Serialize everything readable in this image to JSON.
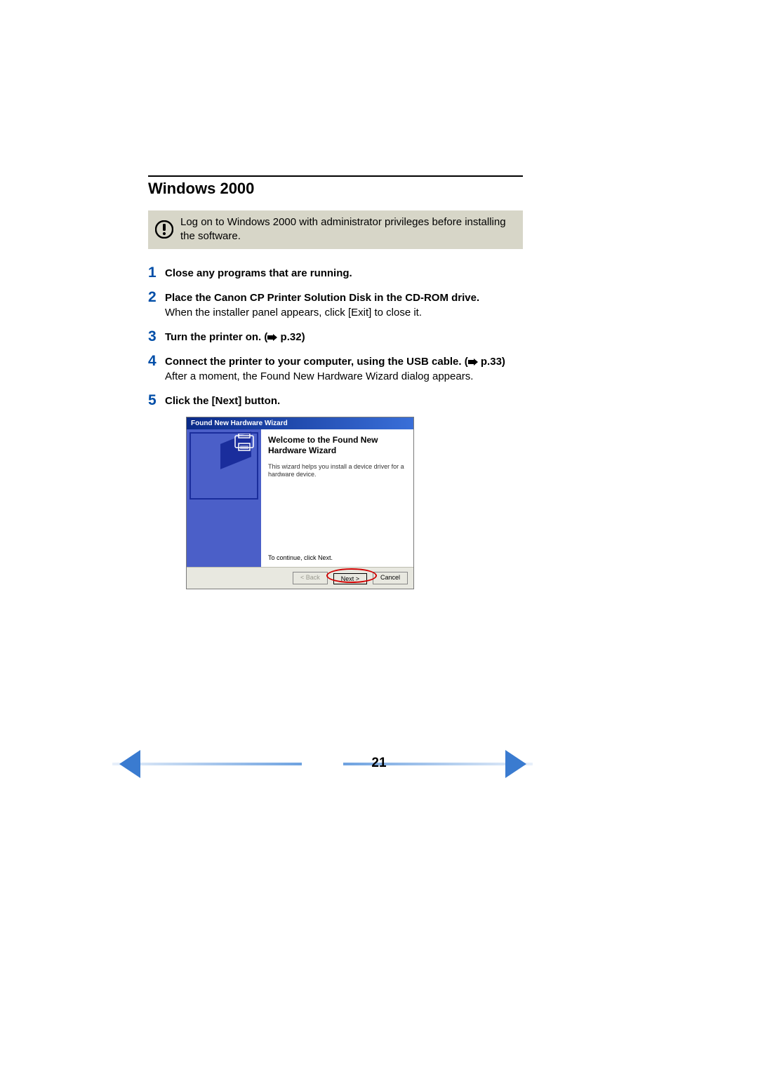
{
  "heading": "Windows 2000",
  "note": "Log on to Windows 2000 with administrator privileges before installing the software.",
  "steps": [
    {
      "num": "1",
      "title": "Close any programs that are running."
    },
    {
      "num": "2",
      "title": "Place the Canon CP Printer Solution Disk in the CD-ROM drive.",
      "sub": "When the installer panel appears, click [Exit] to close it."
    },
    {
      "num": "3",
      "title_pre": "Turn the printer on. (",
      "title_link": "p.32",
      "title_post": ")"
    },
    {
      "num": "4",
      "title_pre": "Connect the printer to your computer, using the USB cable. (",
      "title_link": "p.33",
      "title_post": ")",
      "sub": "After a moment, the Found New Hardware Wizard dialog appears."
    },
    {
      "num": "5",
      "title": "Click the [Next] button."
    }
  ],
  "wizard": {
    "title": "Found New Hardware Wizard",
    "welcome": "Welcome to the Found New Hardware Wizard",
    "desc": "This wizard helps you install a device driver for a hardware device.",
    "continue": "To continue, click Next.",
    "back": "< Back",
    "next": "Next >",
    "cancel": "Cancel"
  },
  "page_number": "21"
}
